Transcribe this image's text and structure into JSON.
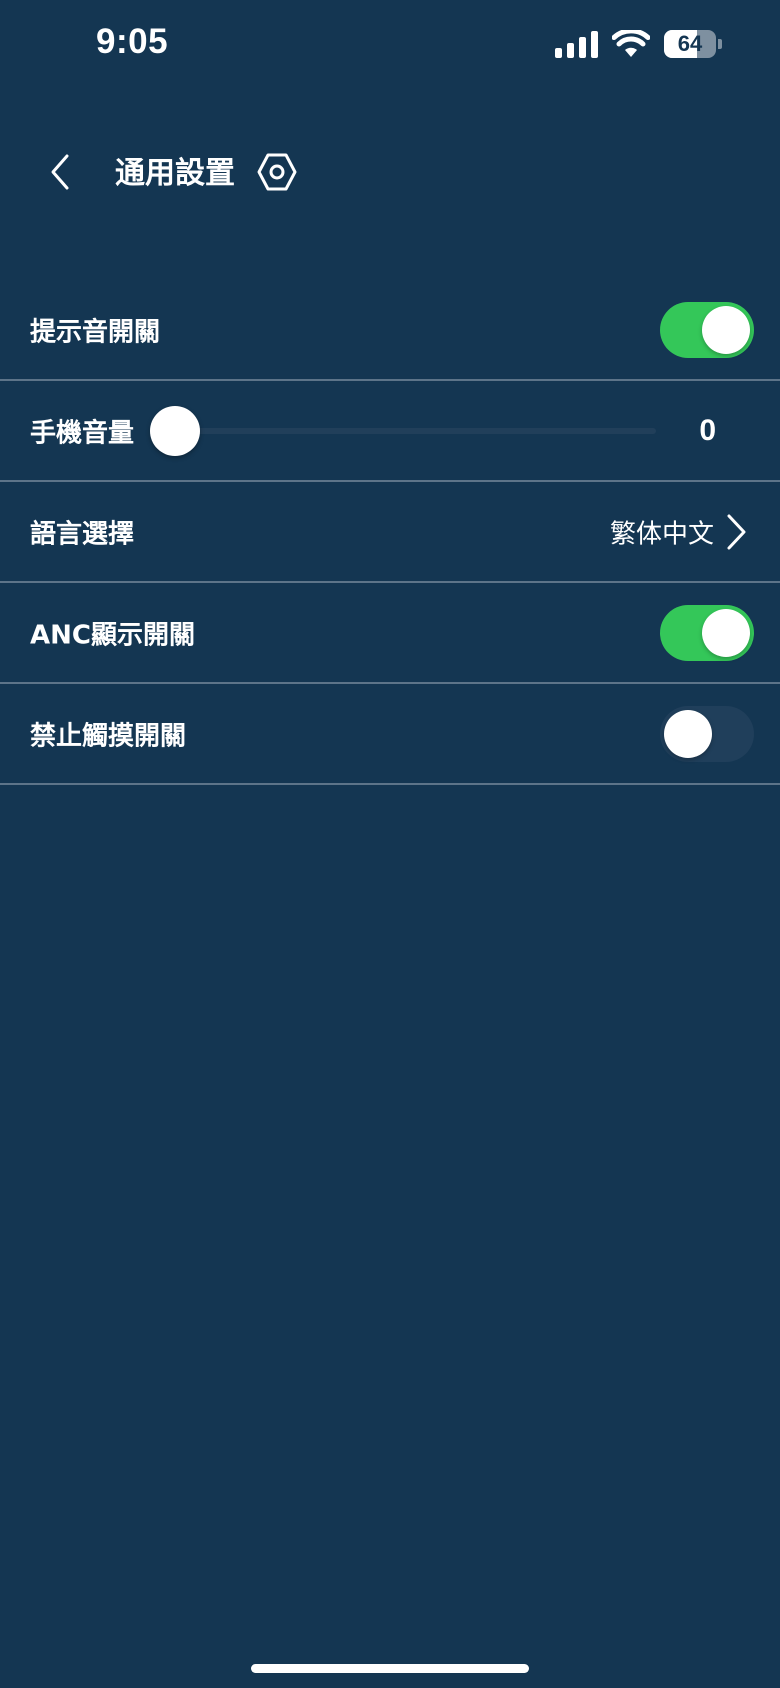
{
  "status_bar": {
    "time": "9:05",
    "battery_level": "64",
    "icons": [
      "signal-icon",
      "wifi-icon",
      "battery-icon"
    ]
  },
  "header": {
    "back_icon": "chevron-left-icon",
    "title": "通用設置",
    "settings_icon": "hex-gear-icon"
  },
  "settings": {
    "prompt_sound": {
      "label": "提示音開關",
      "enabled": true
    },
    "phone_volume": {
      "label": "手機音量",
      "value": "0",
      "level": 0
    },
    "language": {
      "label": "語言選擇",
      "value": "繁体中文",
      "icon": "chevron-right-icon"
    },
    "anc_display": {
      "label": "ANC顯示開關",
      "enabled": true
    },
    "disable_touch": {
      "label": "禁止觸摸開關",
      "enabled": false
    }
  },
  "colors": {
    "background": "#143652",
    "toggle_on": "#34c759",
    "toggle_off": "#203f5b",
    "divider": "#5d7489"
  }
}
